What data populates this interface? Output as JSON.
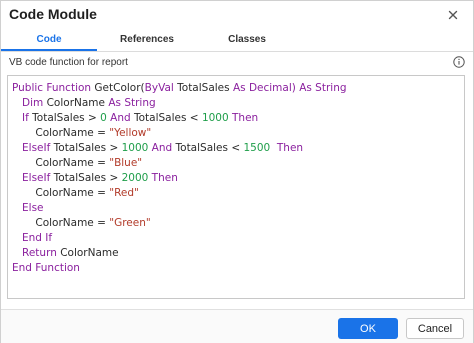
{
  "dialog": {
    "title": "Code Module"
  },
  "tabs": [
    {
      "label": "Code",
      "active": true
    },
    {
      "label": "References",
      "active": false
    },
    {
      "label": "Classes",
      "active": false
    }
  ],
  "section_label": "VB code function for report",
  "icons": {
    "close": "close-icon",
    "info": "info-icon"
  },
  "code_lines": [
    [
      [
        "kw",
        "Public Function "
      ],
      [
        "id",
        "GetColor("
      ],
      [
        "kw",
        "ByVal "
      ],
      [
        "id",
        "TotalSales "
      ],
      [
        "kw",
        "As Decimal) As String"
      ]
    ],
    [
      [
        "kw",
        "   Dim "
      ],
      [
        "id",
        "ColorName "
      ],
      [
        "kw",
        "As String"
      ]
    ],
    [
      [
        "kw",
        "   If "
      ],
      [
        "id",
        "TotalSales > "
      ],
      [
        "num",
        "0"
      ],
      [
        "kw",
        " And "
      ],
      [
        "id",
        "TotalSales < "
      ],
      [
        "num",
        "1000"
      ],
      [
        "kw",
        " Then"
      ]
    ],
    [
      [
        "id",
        "       ColorName = "
      ],
      [
        "str",
        "\"Yellow\""
      ]
    ],
    [
      [
        "kw",
        "   ElseIf "
      ],
      [
        "id",
        "TotalSales > "
      ],
      [
        "num",
        "1000"
      ],
      [
        "kw",
        " And "
      ],
      [
        "id",
        "TotalSales < "
      ],
      [
        "num",
        "1500"
      ],
      [
        "kw",
        "  Then"
      ]
    ],
    [
      [
        "id",
        "       ColorName = "
      ],
      [
        "str",
        "\"Blue\""
      ]
    ],
    [
      [
        "kw",
        "   ElseIf "
      ],
      [
        "id",
        "TotalSales > "
      ],
      [
        "num",
        "2000"
      ],
      [
        "kw",
        " Then"
      ]
    ],
    [
      [
        "id",
        "       ColorName = "
      ],
      [
        "str",
        "\"Red\""
      ]
    ],
    [
      [
        "kw",
        "   Else"
      ]
    ],
    [
      [
        "id",
        "       ColorName = "
      ],
      [
        "str",
        "\"Green\""
      ]
    ],
    [
      [
        "kw",
        "   End If"
      ]
    ],
    [
      [
        "kw",
        "   Return "
      ],
      [
        "id",
        "ColorName"
      ]
    ],
    [
      [
        "kw",
        "End Function"
      ]
    ]
  ],
  "buttons": {
    "ok": "OK",
    "cancel": "Cancel"
  },
  "colors": {
    "accent": "#1a73e8",
    "keyword": "#8a1f9e",
    "number": "#1f9e4a",
    "string": "#b23b2a"
  }
}
